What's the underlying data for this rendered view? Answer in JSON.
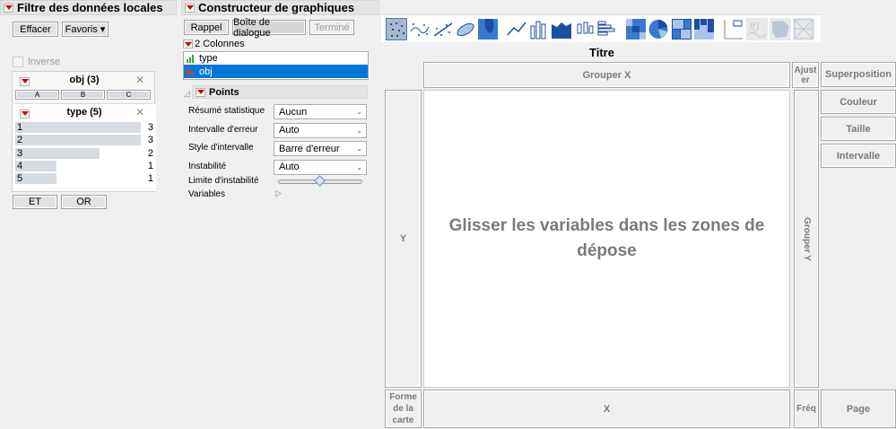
{
  "filter": {
    "title": "Filtre des données locales",
    "clear": "Effacer",
    "favorites": "Favoris",
    "inverse": "Inverse",
    "obj": {
      "title": "obj (3)",
      "levels": [
        "A",
        "B",
        "C"
      ]
    },
    "type": {
      "title": "type (5)",
      "levels": [
        {
          "label": "1",
          "count": "3",
          "frac": 1.0
        },
        {
          "label": "2",
          "count": "3",
          "frac": 1.0
        },
        {
          "label": "3",
          "count": "2",
          "frac": 0.67
        },
        {
          "label": "4",
          "count": "1",
          "frac": 0.33
        },
        {
          "label": "5",
          "count": "1",
          "frac": 0.33
        }
      ]
    },
    "and": "ET",
    "or": "OR"
  },
  "builder": {
    "title": "Constructeur de graphiques",
    "recall": "Rappel",
    "dialog": "Boîte de dialogue",
    "done": "Terminé",
    "columns_label": "2 Colonnes",
    "columns": [
      "type",
      "obj"
    ],
    "points": {
      "title": "Points",
      "rows": [
        {
          "label": "Résumé statistique",
          "value": "Aucun"
        },
        {
          "label": "Intervalle d'erreur",
          "value": "Auto"
        },
        {
          "label": "Style d'intervalle",
          "value": "Barre d'erreur"
        },
        {
          "label": "Instabilité",
          "value": "Auto"
        }
      ],
      "jitter_limit": "Limite d'instabilité",
      "jitter_value": 0.5,
      "variables": "Variables"
    }
  },
  "graph": {
    "title": "Titre",
    "group_x": "Grouper X",
    "fit": "Ajuster",
    "overlay": "Superposition",
    "color": "Couleur",
    "size": "Taille",
    "interval": "Intervalle",
    "y": "Y",
    "group_y": "Grouper Y",
    "placeholder": "Glisser les variables dans les zones de dépose",
    "map_shape": "Forme de la carte",
    "x": "X",
    "freq": "Fréq",
    "page": "Page"
  },
  "toolbar": [
    "points-icon",
    "smoother-icon",
    "line-of-fit-icon",
    "ellipse-icon",
    "contour-icon",
    "line-icon",
    "bar-icon",
    "area-icon",
    "box-plot-icon",
    "histogram-icon",
    "heatmap-icon",
    "pie-icon",
    "treemap-icon",
    "mosaic-icon",
    "caption-box-icon",
    "formula-icon",
    "map-shapes-icon",
    "parallel-icon"
  ]
}
